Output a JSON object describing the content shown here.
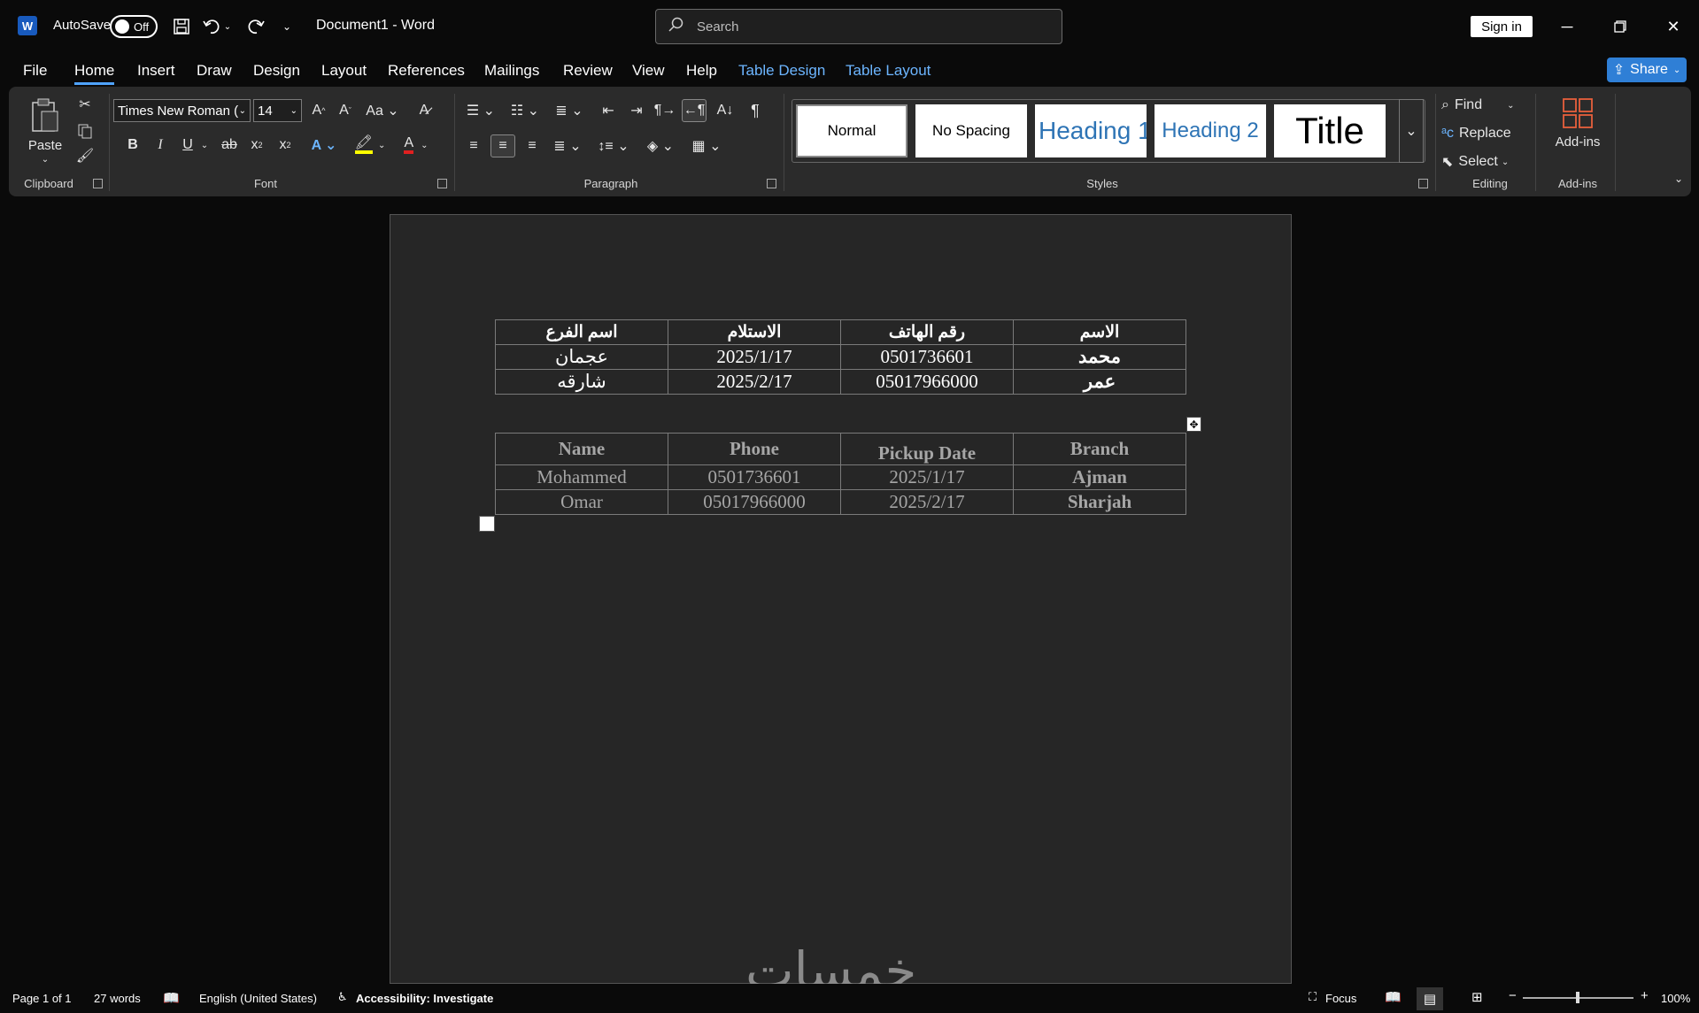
{
  "titlebar": {
    "autosave_label": "AutoSave",
    "autosave_state": "Off",
    "document_title": "Document1  -  Word",
    "search_placeholder": "Search",
    "sign_in": "Sign in"
  },
  "tabs": [
    "File",
    "Home",
    "Insert",
    "Draw",
    "Design",
    "Layout",
    "References",
    "Mailings",
    "Review",
    "View",
    "Help",
    "Table Design",
    "Table Layout"
  ],
  "share_label": "Share",
  "ribbon": {
    "clipboard": {
      "paste": "Paste",
      "label": "Clipboard"
    },
    "font": {
      "family": "Times New Roman (",
      "size": "14",
      "label": "Font"
    },
    "paragraph": {
      "label": "Paragraph"
    },
    "styles": {
      "items": [
        "Normal",
        "No Spacing",
        "Heading 1",
        "Heading 2",
        "Title"
      ],
      "label": "Styles"
    },
    "editing": {
      "find": "Find",
      "replace": "Replace",
      "select": "Select",
      "label": "Editing"
    },
    "addins": {
      "button": "Add-ins",
      "label": "Add-ins"
    }
  },
  "table_arabic": {
    "headers": [
      "اسم الفرع",
      "الاستلام",
      "رقم الهاتف",
      "الاسم"
    ],
    "rows": [
      [
        "عجمان",
        "2025/1/17",
        "0501736601",
        "محمد"
      ],
      [
        "شارقه",
        "2025/2/17",
        "05017966000",
        "عمر"
      ]
    ]
  },
  "table_english": {
    "headers": [
      "Name",
      "Phone",
      "Pickup Date",
      "Branch"
    ],
    "rows": [
      [
        "Mohammed",
        "0501736601",
        "2025/1/17",
        "Ajman"
      ],
      [
        "Omar",
        "05017966000",
        "2025/2/17",
        "Sharjah"
      ]
    ]
  },
  "watermark": "خمسات",
  "status": {
    "page": "Page 1 of 1",
    "words": "27 words",
    "language": "English (United States)",
    "accessibility": "Accessibility: Investigate",
    "focus": "Focus",
    "zoom": "100%"
  },
  "colors": {
    "accent": "#4fa3ff",
    "share": "#2f7fd6",
    "ribbon": "#2b2b2b",
    "page": "#262626"
  }
}
